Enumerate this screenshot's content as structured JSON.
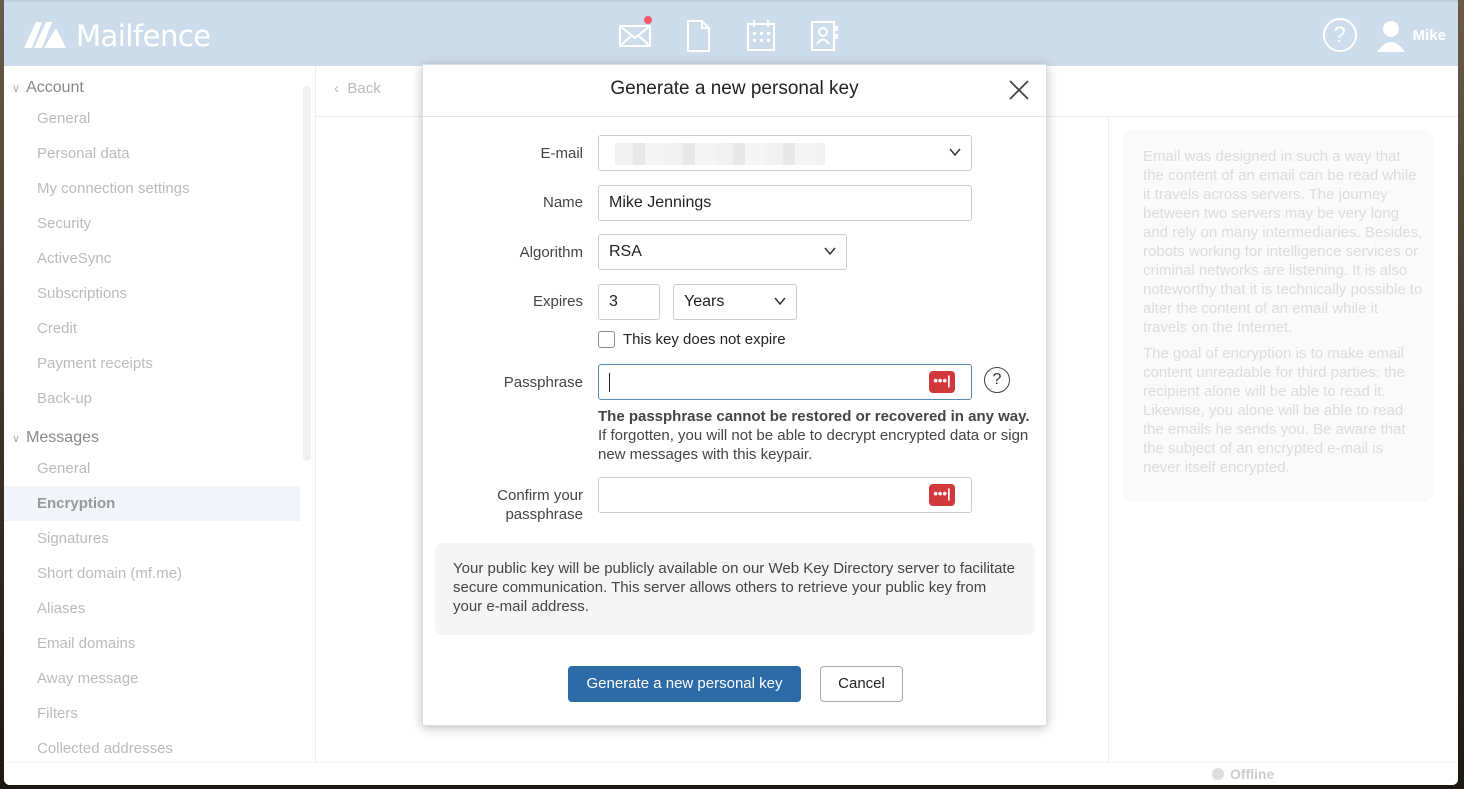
{
  "app": {
    "brand": "Mailfence",
    "user_name": "Mike",
    "help_glyph": "?",
    "status": "Offline",
    "nav_icons": [
      "mail-icon",
      "document-icon",
      "calendar-icon",
      "contacts-icon"
    ]
  },
  "sidebar": {
    "sections": [
      {
        "title": "Account",
        "items": [
          "General",
          "Personal data",
          "My connection settings",
          "Security",
          "ActiveSync",
          "Subscriptions",
          "Credit",
          "Payment receipts",
          "Back-up"
        ]
      },
      {
        "title": "Messages",
        "items": [
          "General",
          "Encryption",
          "Signatures",
          "Short domain (mf.me)",
          "Aliases",
          "Email domains",
          "Away message",
          "Filters",
          "Collected addresses"
        ]
      }
    ],
    "active_item": "Encryption"
  },
  "main": {
    "back_label": "Back",
    "info_paragraphs": [
      "Email was designed in such a way that the content of an email can be read while it travels across servers. The journey between two servers may be very long and rely on many intermediaries. Besides, robots working for intelligence services or criminal networks are listening. It is also noteworthy that it is technically possible to alter the content of an email while it travels on the Internet.",
      "The goal of encryption is to make email content unreadable for third parties: the recipient alone will be able to read it. Likewise, you alone will be able to read the emails he sends you. Be aware that the subject of an encrypted e-mail is never itself encrypted."
    ]
  },
  "modal": {
    "title": "Generate a new personal key",
    "email_label": "E-mail",
    "name_label": "Name",
    "name_value": "Mike Jennings",
    "algorithm_label": "Algorithm",
    "algorithm_value": "RSA",
    "expires_label": "Expires",
    "expires_number": "3",
    "expires_unit": "Years",
    "no_expire_label": "This key does not expire",
    "no_expire_checked": false,
    "passphrase_label": "Passphrase",
    "password_manager_glyph": "•••|",
    "passphrase_help": "?",
    "warning_bold": "The passphrase cannot be restored or recovered in any way.",
    "warning_text": "If forgotten, you will not be able to decrypt encrypted data or sign new messages with this keypair.",
    "confirm_label_line1": "Confirm your",
    "confirm_label_line2": "passphrase",
    "note": "Your public key will be publicly available on our Web Key Directory server to facilitate secure communication. This server allows others to retrieve your public key from your e-mail address.",
    "primary_button": "Generate a new personal key",
    "cancel_button": "Cancel",
    "primary_color": "#2c6aa8",
    "password_icon_color": "#d0383c"
  }
}
